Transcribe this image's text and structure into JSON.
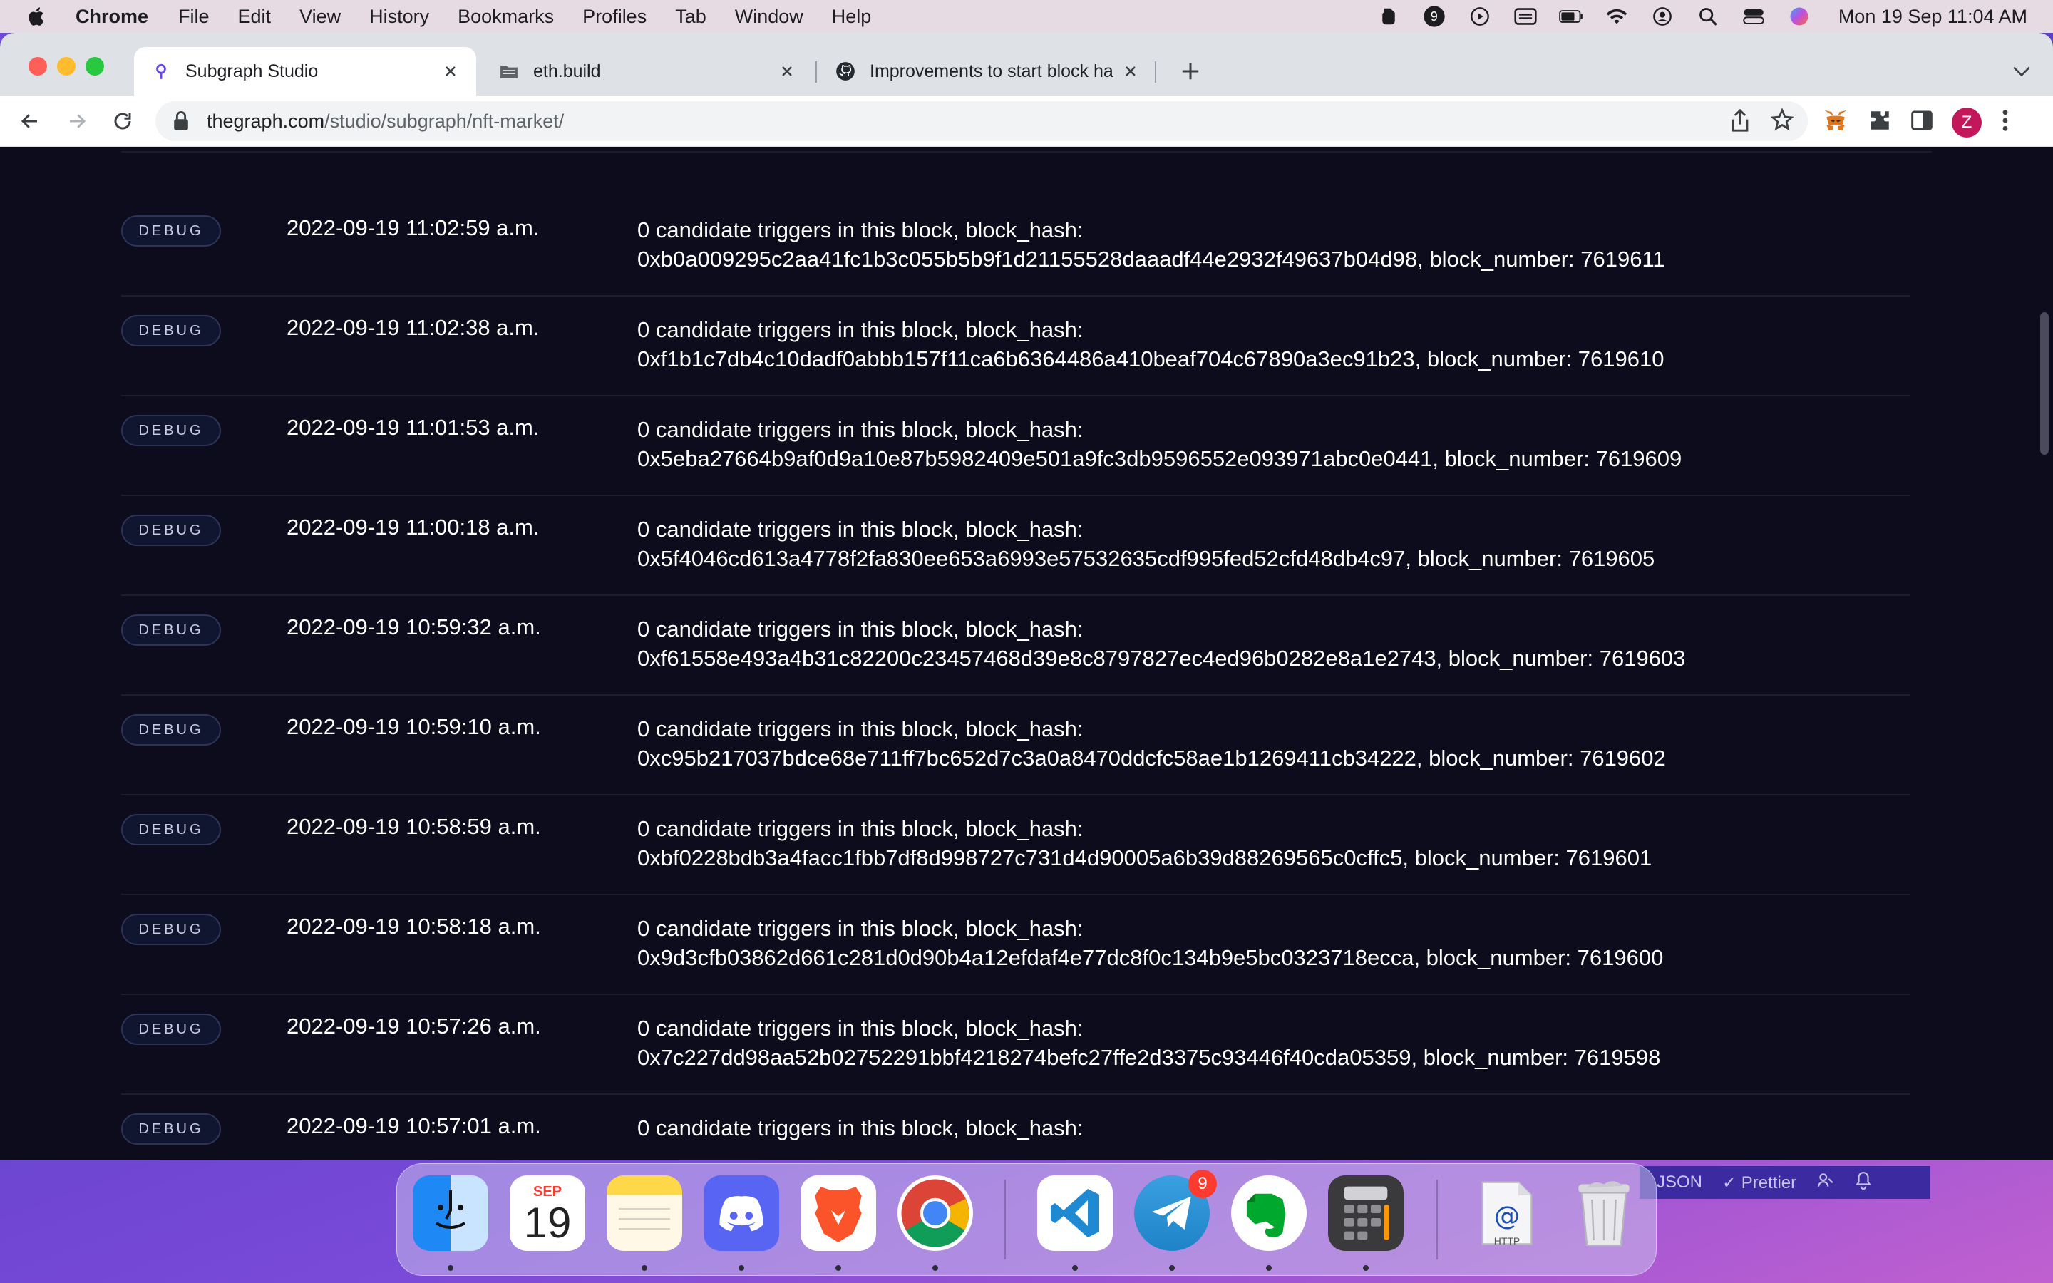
{
  "menubar": {
    "app_name": "Chrome",
    "items": [
      "File",
      "Edit",
      "View",
      "History",
      "Bookmarks",
      "Profiles",
      "Tab",
      "Window",
      "Help"
    ],
    "status_icons": [
      "evernote-icon",
      "notification-9-icon",
      "play-icon",
      "keyboard-icon",
      "battery-icon",
      "wifi-icon",
      "user-icon",
      "search-icon",
      "control-center-icon",
      "siri-icon"
    ],
    "notification_count": "9",
    "clock": "Mon 19 Sep  11:04 AM"
  },
  "browser": {
    "tabs": [
      {
        "title": "Subgraph Studio",
        "icon": "subgraph-icon",
        "active": true
      },
      {
        "title": "eth.build",
        "icon": "folder-icon",
        "active": false
      },
      {
        "title": "Improvements to start block ha",
        "icon": "github-icon",
        "active": false
      }
    ],
    "url_host": "thegraph.com",
    "url_path": "/studio/subgraph/nft-market/",
    "profile_initial": "Z"
  },
  "logs": [
    {
      "level": "DEBUG",
      "time": "2022-09-19 11:02:59 a.m.",
      "line1": "0 candidate triggers in this block, block_hash:",
      "line2": "0xb0a009295c2aa41fc1b3c055b5b9f1d21155528daaadf44e2932f49637b04d98, block_number: 7619611"
    },
    {
      "level": "DEBUG",
      "time": "2022-09-19 11:02:38 a.m.",
      "line1": "0 candidate triggers in this block, block_hash:",
      "line2": "0xf1b1c7db4c10dadf0abbb157f11ca6b6364486a410beaf704c67890a3ec91b23, block_number: 7619610"
    },
    {
      "level": "DEBUG",
      "time": "2022-09-19 11:01:53 a.m.",
      "line1": "0 candidate triggers in this block, block_hash:",
      "line2": "0x5eba27664b9af0d9a10e87b5982409e501a9fc3db9596552e093971abc0e0441, block_number: 7619609"
    },
    {
      "level": "DEBUG",
      "time": "2022-09-19 11:00:18 a.m.",
      "line1": "0 candidate triggers in this block, block_hash:",
      "line2": "0x5f4046cd613a4778f2fa830ee653a6993e57532635cdf995fed52cfd48db4c97, block_number: 7619605"
    },
    {
      "level": "DEBUG",
      "time": "2022-09-19 10:59:32 a.m.",
      "line1": "0 candidate triggers in this block, block_hash:",
      "line2": "0xf61558e493a4b31c82200c23457468d39e8c8797827ec4ed96b0282e8a1e2743, block_number: 7619603"
    },
    {
      "level": "DEBUG",
      "time": "2022-09-19 10:59:10 a.m.",
      "line1": "0 candidate triggers in this block, block_hash:",
      "line2": "0xc95b217037bdce68e711ff7bc652d7c3a0a8470ddcfc58ae1b1269411cb34222, block_number: 7619602"
    },
    {
      "level": "DEBUG",
      "time": "2022-09-19 10:58:59 a.m.",
      "line1": "0 candidate triggers in this block, block_hash:",
      "line2": "0xbf0228bdb3a4facc1fbb7df8d998727c731d4d90005a6b39d88269565c0cffc5, block_number: 7619601"
    },
    {
      "level": "DEBUG",
      "time": "2022-09-19 10:58:18 a.m.",
      "line1": "0 candidate triggers in this block, block_hash:",
      "line2": "0x9d3cfb03862d661c281d0d90b4a12efdaf4e77dc8f0c134b9e5bc0323718ecca, block_number: 7619600"
    },
    {
      "level": "DEBUG",
      "time": "2022-09-19 10:57:26 a.m.",
      "line1": "0 candidate triggers in this block, block_hash:",
      "line2": "0x7c227dd98aa52b02752291bbf4218274befc27ffe2d3375c93446f40cda05359, block_number: 7619598"
    },
    {
      "level": "DEBUG",
      "time": "2022-09-19 10:57:01 a.m.",
      "line1": "0 candidate triggers in this block, block_hash:",
      "line2": ""
    }
  ],
  "editor_status": {
    "language": "JSON",
    "formatter": "✓ Prettier"
  },
  "dock": {
    "apps": [
      "finder",
      "calendar",
      "notes",
      "discord",
      "brave",
      "chrome",
      "vscode",
      "telegram",
      "evernote",
      "calculator",
      "http-document",
      "trash"
    ],
    "calendar_month": "SEP",
    "calendar_day": "19",
    "telegram_badge": "9",
    "http_label": "HTTP"
  },
  "colors": {
    "page_bg": "#0c0c1d",
    "badge_border": "#2e3358",
    "row_divider": "#1d1d2f",
    "menubar_bg": "#e6dbe3"
  }
}
